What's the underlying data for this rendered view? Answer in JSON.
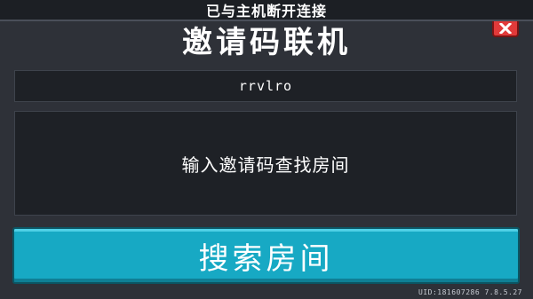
{
  "status_bar": {
    "text": "已与主机断开连接"
  },
  "dialog": {
    "title": "邀请码联机",
    "room_code_field": {
      "value": "rrvlro"
    },
    "hint_panel": {
      "text": "输入邀请码查找房间"
    },
    "search_button": {
      "label": "搜索房间"
    },
    "close_button": {
      "icon": "close-icon",
      "color": "#e23a3a"
    }
  },
  "footer": {
    "uid_version": "UID:181607286 7.8.5.27"
  },
  "colors": {
    "background": "#2e3138",
    "panel": "#1e2126",
    "accent_button": "#17a9c4",
    "close_button": "#e23a3a"
  }
}
